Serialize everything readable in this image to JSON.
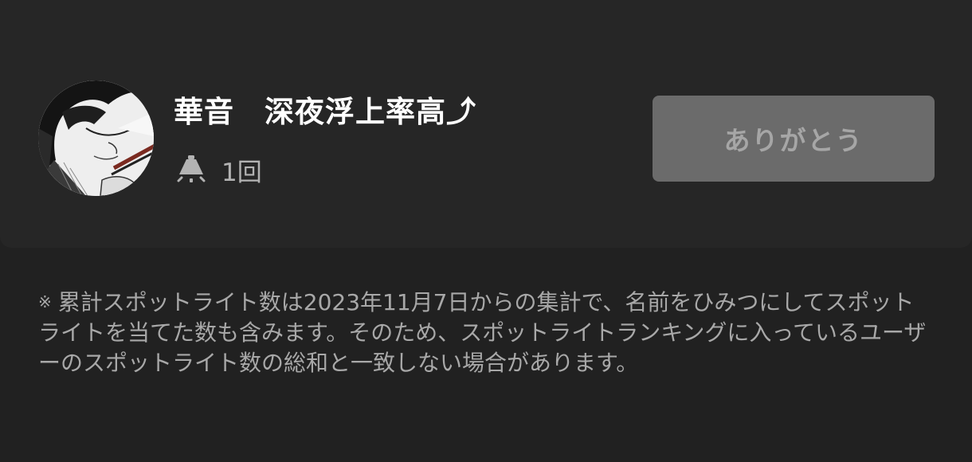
{
  "profile": {
    "name": "華音　深夜浮上率高⤴",
    "spotlight_count": "1回"
  },
  "actions": {
    "thanks_label": "ありがとう"
  },
  "footer": {
    "note_mark": "※",
    "note_text": "累計スポットライト数は2023年11月7日からの集計で、名前をひみつにしてスポットライトを当てた数も含みます。そのため、スポットライトランキングに入っているユーザーのスポットライト数の総和と一致しない場合があります。"
  },
  "icons": {
    "avatar": "avatar-illustration",
    "count": "spotlight-icon"
  },
  "colors": {
    "background": "#212121",
    "card": "#262626",
    "button": "#6b6b6b",
    "button_text": "#a6a6a6",
    "title": "#ffffff",
    "muted_text": "#a8a8a8"
  }
}
